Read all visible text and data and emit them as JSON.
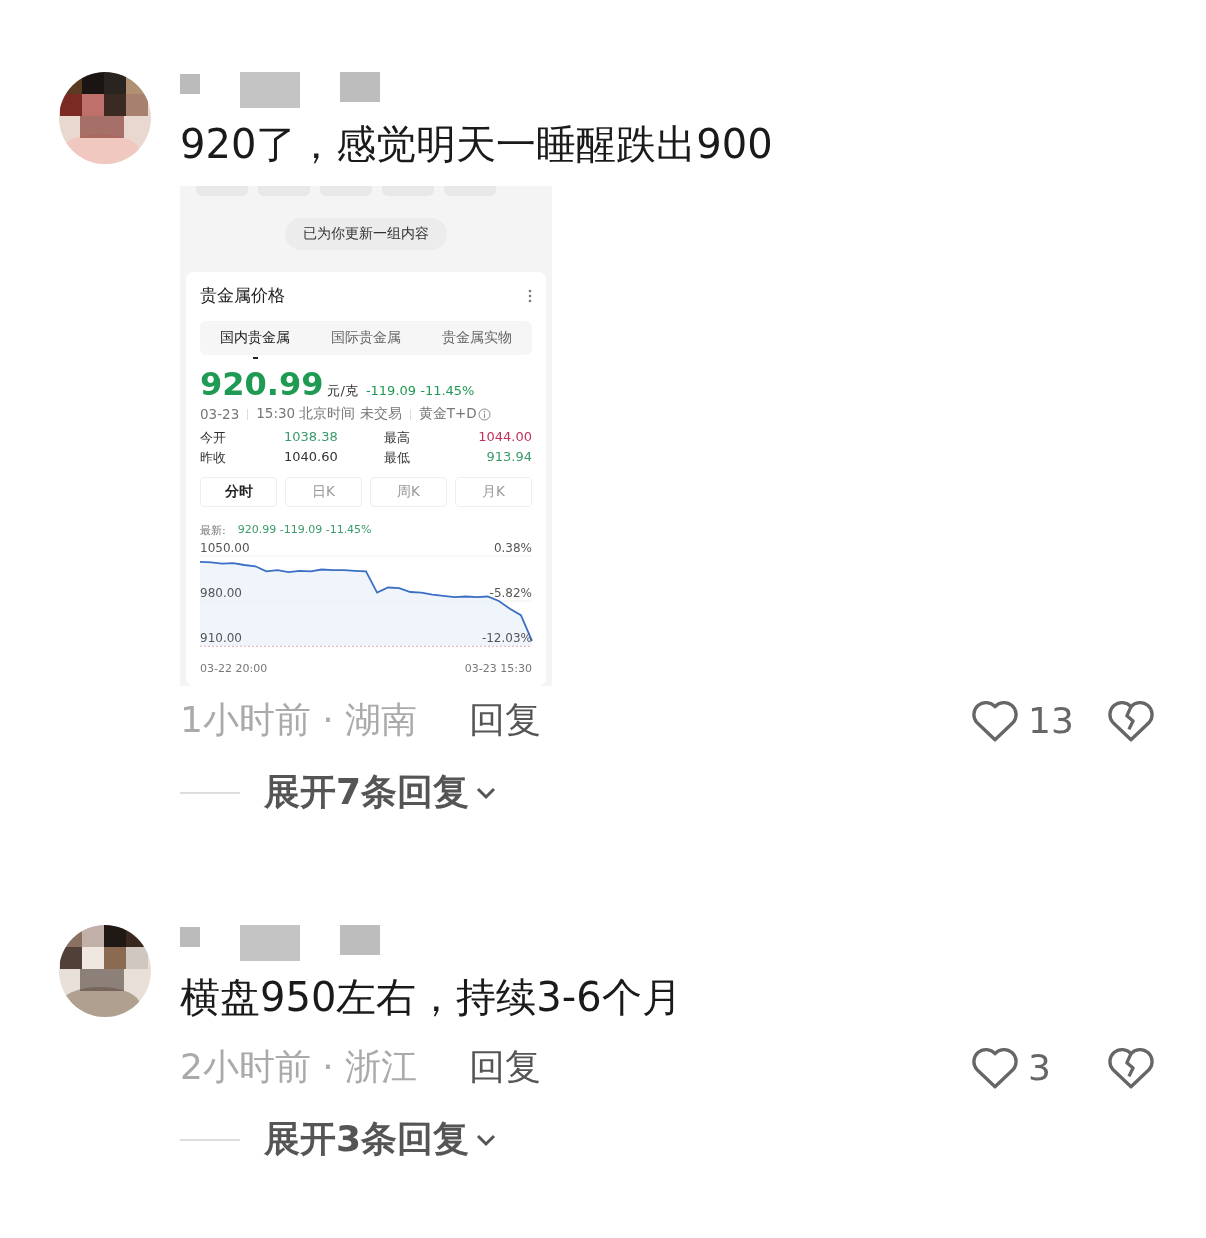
{
  "comments": [
    {
      "text": "920了，感觉明天一睡醒跌出900",
      "meta": "1小时前 · 湖南",
      "reply": "回复",
      "likes": "13",
      "expand": "展开7条回复",
      "attachment": {
        "notice": "已为你更新一组内容",
        "card_title": "贵金属价格",
        "tabs": [
          {
            "label": "国内贵金属",
            "selected": true
          },
          {
            "label": "国际贵金属",
            "selected": false
          },
          {
            "label": "贵金属实物",
            "selected": false
          }
        ],
        "price": "920.99",
        "unit": "元/克",
        "change": "-119.09 -11.45%",
        "info": [
          {
            "text": "03-23"
          },
          {
            "text": "15:30 北京时间 未交易"
          },
          {
            "text": "黄金T+D"
          }
        ],
        "stats": [
          {
            "label": "今开",
            "value": "1038.38",
            "color": "#3a9a6a"
          },
          {
            "label": "最高",
            "value": "1044.00",
            "color": "#c0305a"
          },
          {
            "label": "昨收",
            "value": "1040.60",
            "color": "#333333"
          },
          {
            "label": "最低",
            "value": "913.94",
            "color": "#3a9a6a"
          }
        ],
        "periods": [
          {
            "label": "分时",
            "selected": true
          },
          {
            "label": "日K",
            "selected": false
          },
          {
            "label": "周K",
            "selected": false
          },
          {
            "label": "月K",
            "selected": false
          }
        ],
        "latest_label": "最新:",
        "latest_value": "920.99 -119.09 -11.45%",
        "y2ticks": [
          "0.38%",
          "-5.82%",
          "-12.03%"
        ],
        "xlabels": [
          "03-22 20:00",
          "03-23 15:30"
        ],
        "chart_data": {
          "type": "area",
          "yticks": [
            {
              "value": 1050,
              "label": "1050.00"
            },
            {
              "value": 980,
              "label": "980.00"
            },
            {
              "value": 910,
              "label": "910.00"
            }
          ],
          "ylim": [
            910,
            1050
          ],
          "series": [
            {
              "color": "#3b6fc4",
              "values": [
                1041,
                1040,
                1038,
                1039,
                1036,
                1034,
                1026,
                1028,
                1025,
                1027,
                1026,
                1029,
                1028,
                1028,
                1027,
                1026,
                993,
                1001,
                1000,
                994,
                993,
                990,
                988,
                986,
                987,
                986,
                987,
                980,
                968,
                958,
                918
              ]
            }
          ]
        }
      }
    },
    {
      "text": "横盘950左右，持续3-6个月",
      "meta": "2小时前 · 浙江",
      "reply": "回复",
      "likes": "3",
      "expand": "展开3条回复"
    }
  ]
}
